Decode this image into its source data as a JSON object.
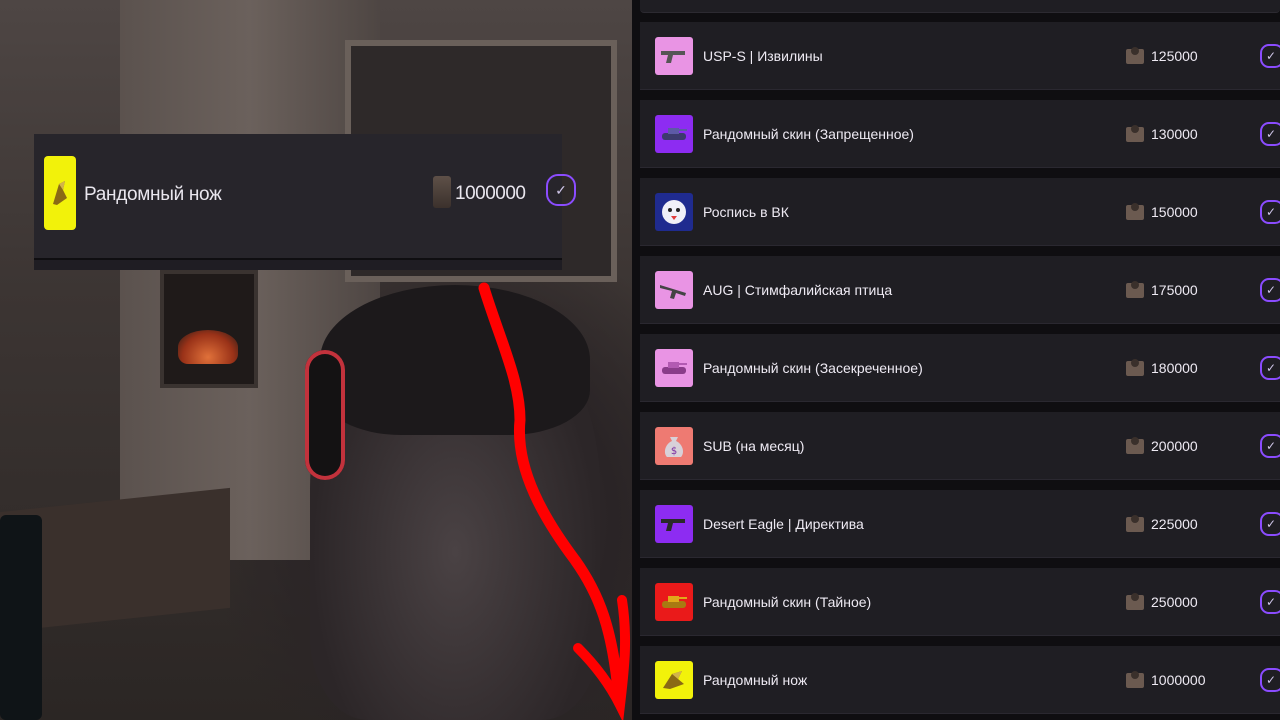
{
  "overlay": {
    "name": "Рандомный нож",
    "cost": "1000000",
    "thumb_color": "#f2f20a",
    "check_glyph": "✓"
  },
  "rewards": [
    {
      "label": "USP-S | Извилины",
      "price": "125000",
      "color": "#e994e4",
      "icon": "pistol-icon"
    },
    {
      "label": "Рандомный скин (Запрещенное)",
      "price": "130000",
      "color": "#8d2cf2",
      "icon": "tank-icon"
    },
    {
      "label": "Роспись в ВК",
      "price": "150000",
      "color": "#1f2b8f",
      "icon": "vk-bird-icon"
    },
    {
      "label": "AUG | Стимфалийская птица",
      "price": "175000",
      "color": "#e994e4",
      "icon": "rifle-icon"
    },
    {
      "label": "Рандомный скин (Засекреченное)",
      "price": "180000",
      "color": "#e994e4",
      "icon": "tank-icon"
    },
    {
      "label": "SUB (на месяц)",
      "price": "200000",
      "color": "#ee7a72",
      "icon": "money-bag-icon"
    },
    {
      "label": "Desert Eagle | Директива",
      "price": "225000",
      "color": "#8d2cf2",
      "icon": "pistol-icon"
    },
    {
      "label": "Рандомный скин (Тайное)",
      "price": "250000",
      "color": "#ea1a1a",
      "icon": "tank-icon"
    },
    {
      "label": "Рандомный нож",
      "price": "1000000",
      "color": "#f2f20a",
      "icon": "knife-icon"
    }
  ],
  "colors": {
    "accent": "#8b4cff",
    "row_bg": "#1f1e23",
    "arrow": "#ff0000"
  }
}
